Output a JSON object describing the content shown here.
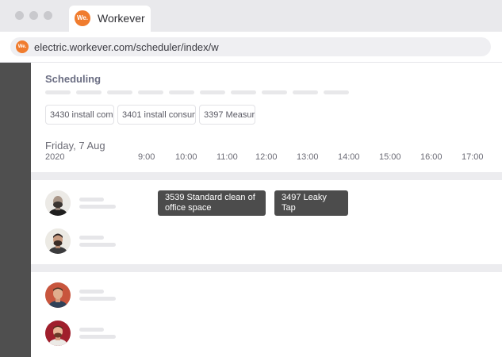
{
  "browser": {
    "tab": {
      "logo_text": "We.",
      "title": "Workever"
    },
    "address": {
      "logo_text": "We.",
      "url": "electric.workever.com/scheduler/index/w"
    }
  },
  "scheduler": {
    "title": "Scheduling",
    "filters": [
      "3430 install com",
      "3401 install consum",
      "3397 Measur"
    ],
    "date": {
      "weekday_day_month": "Friday, 7 Aug",
      "year": "2020"
    },
    "hours": [
      "9:00",
      "10:00",
      "11:00",
      "12:00",
      "13:00",
      "14:00",
      "15:00",
      "16:00",
      "17:00"
    ],
    "jobs": [
      {
        "label": "3539 Standard clean of office space"
      },
      {
        "label": "3497 Leaky Tap"
      }
    ]
  },
  "colors": {
    "brand_orange": "#f07c2e",
    "job_block": "#4c4c4c",
    "left_rail": "#4f4f4f",
    "title_text": "#6b6e83"
  },
  "icons": [
    "close-dot",
    "minimize-dot",
    "maximize-dot",
    "workever-logo",
    "avatar-photo"
  ]
}
